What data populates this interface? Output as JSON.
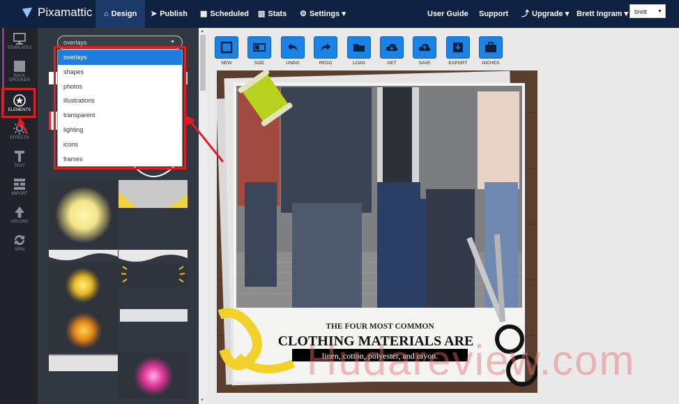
{
  "nav": {
    "logo": "Pixamattic",
    "items": [
      {
        "label": "Design",
        "icon": "home-icon"
      },
      {
        "label": "Publish",
        "icon": "paper-plane-icon"
      },
      {
        "label": "Scheduled",
        "icon": "calendar-icon"
      },
      {
        "label": "Stats",
        "icon": "chart-icon"
      },
      {
        "label": "Settings",
        "icon": "gear-icon"
      }
    ],
    "right": [
      {
        "label": "User Guide"
      },
      {
        "label": "Support"
      },
      {
        "label": "Upgrade"
      },
      {
        "label": "Brett Ingram"
      }
    ],
    "user_select_value": "brett"
  },
  "sidebar": {
    "items": [
      {
        "label": "TEMPLATES",
        "icon": "monitor-icon"
      },
      {
        "label": "BACK GROUNDS",
        "icon": "square-icon"
      },
      {
        "label": "ELEMENTS",
        "icon": "star-circle-icon"
      },
      {
        "label": "EFFECTS",
        "icon": "sun-icon"
      },
      {
        "label": "TEXT",
        "icon": "text-icon"
      },
      {
        "label": "IMPORT",
        "icon": "import-icon"
      },
      {
        "label": "UPLOAD",
        "icon": "upload-arrow-icon"
      },
      {
        "label": "SPIN",
        "icon": "spin-icon"
      }
    ]
  },
  "panel": {
    "category_value": "overlays",
    "options": [
      "overlays",
      "shapes",
      "photos",
      "illustrations",
      "transparent",
      "lighting",
      "icons",
      "frames"
    ]
  },
  "toolbar": {
    "items": [
      "NEW",
      "SIZE",
      "UNDO",
      "REDO",
      "LOAD",
      "GET",
      "SAVE",
      "EXPORT",
      "NICHES"
    ]
  },
  "design": {
    "line1": "THE FOUR MOST COMMON",
    "line2": "CLOTHING MATERIALS ARE",
    "line3": "linen, cotton, polyester, and rayon."
  },
  "watermark": "Hudareview.com",
  "colors": {
    "nav_bg": "#0f2140",
    "accent": "#1b83e6",
    "highlight": "#e11d20"
  }
}
